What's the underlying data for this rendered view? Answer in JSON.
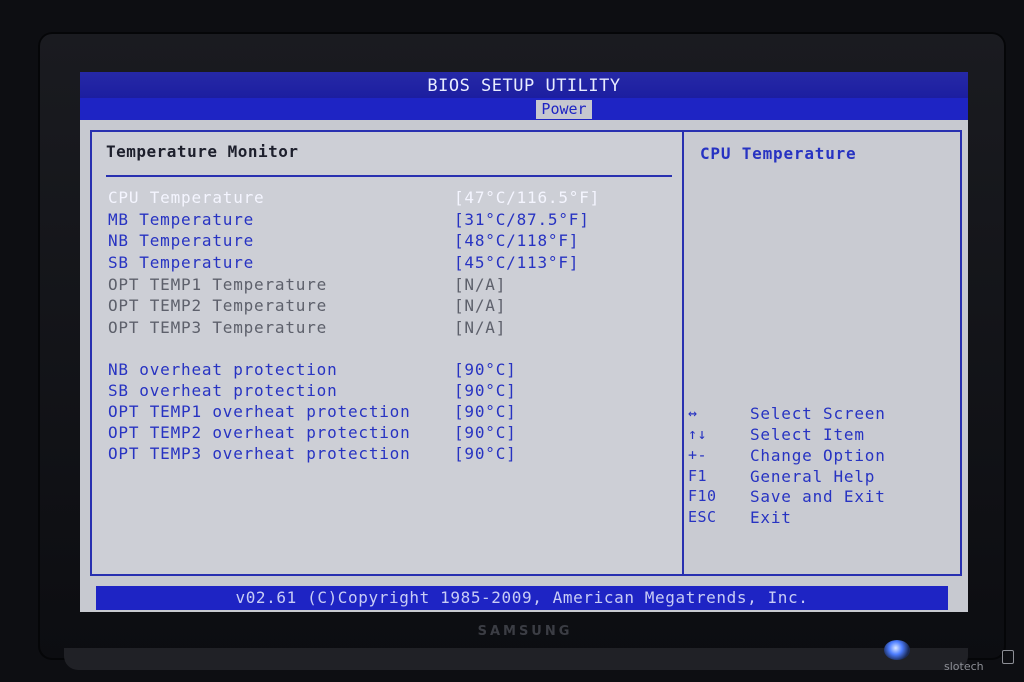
{
  "bios": {
    "title": "BIOS SETUP UTILITY",
    "active_tab": "Power",
    "section_title": "Temperature Monitor",
    "temperatures": [
      {
        "label": "CPU Temperature",
        "value": "[47°C/116.5°F]",
        "state": "selected"
      },
      {
        "label": "MB Temperature",
        "value": "[31°C/87.5°F]",
        "state": "active"
      },
      {
        "label": "NB Temperature",
        "value": "[48°C/118°F]",
        "state": "active"
      },
      {
        "label": "SB Temperature",
        "value": "[45°C/113°F]",
        "state": "active"
      },
      {
        "label": "OPT TEMP1 Temperature",
        "value": "[N/A]",
        "state": "disabled"
      },
      {
        "label": "OPT TEMP2 Temperature",
        "value": "[N/A]",
        "state": "disabled"
      },
      {
        "label": "OPT TEMP3 Temperature",
        "value": "[N/A]",
        "state": "disabled"
      }
    ],
    "protections": [
      {
        "label": "NB overheat protection",
        "value": "[90°C]"
      },
      {
        "label": "SB overheat protection",
        "value": "[90°C]"
      },
      {
        "label": "OPT TEMP1 overheat protection",
        "value": "[90°C]"
      },
      {
        "label": "OPT TEMP2 overheat protection",
        "value": "[90°C]"
      },
      {
        "label": "OPT TEMP3 overheat protection",
        "value": "[90°C]"
      }
    ],
    "help_title": "CPU Temperature",
    "keys": [
      {
        "key": "↔",
        "action": "Select Screen"
      },
      {
        "key": "↑↓",
        "action": "Select Item"
      },
      {
        "key": "+-",
        "action": "Change Option"
      },
      {
        "key": "F1",
        "action": "General Help"
      },
      {
        "key": "F10",
        "action": "Save and Exit"
      },
      {
        "key": "ESC",
        "action": "Exit"
      }
    ],
    "footer": "v02.61 (C)Copyright 1985-2009, American Megatrends, Inc.",
    "colors": {
      "title_bar": "#1c1ea0",
      "accent_blue": "#1e24c4",
      "panel": "#cdcfd6",
      "text_blue": "#2733c2"
    }
  },
  "monitor": {
    "brand": "SAMSUNG",
    "watermark": "slotech"
  }
}
